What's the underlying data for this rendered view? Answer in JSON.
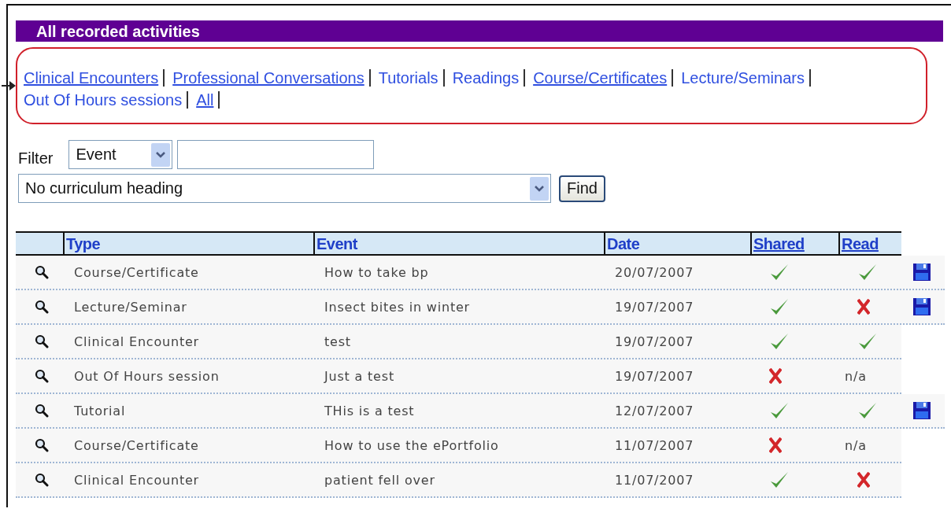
{
  "title": "All recorded activities",
  "categories": [
    {
      "label": "Clinical Encounters",
      "underlined": true
    },
    {
      "label": "Professional Conversations",
      "underlined": true
    },
    {
      "label": "Tutorials",
      "underlined": false
    },
    {
      "label": "Readings",
      "underlined": false
    },
    {
      "label": "Course/Certificates",
      "underlined": true
    },
    {
      "label": "Lecture/Seminars",
      "underlined": false
    },
    {
      "label": "Out Of Hours sessions",
      "underlined": false
    },
    {
      "label": "All",
      "underlined": true
    }
  ],
  "filter": {
    "label": "Filter",
    "field": "Event",
    "heading": "No curriculum heading",
    "button": "Find"
  },
  "table": {
    "columns": [
      {
        "label": "Type",
        "sortable": false
      },
      {
        "label": "Event",
        "sortable": false
      },
      {
        "label": "Date",
        "sortable": false
      },
      {
        "label": "Shared",
        "sortable": true
      },
      {
        "label": "Read",
        "sortable": true
      }
    ],
    "rows": [
      {
        "type": "Course/Certificate",
        "event": "How to take bp",
        "date": "20/07/2007",
        "shared": true,
        "read": {
          "kind": "yes"
        },
        "saved": true
      },
      {
        "type": "Lecture/Seminar",
        "event": "Insect bites in winter",
        "date": "19/07/2007",
        "shared": true,
        "read": {
          "kind": "no"
        },
        "saved": true
      },
      {
        "type": "Clinical Encounter",
        "event": "test",
        "date": "19/07/2007",
        "shared": true,
        "read": {
          "kind": "yes"
        },
        "saved": false
      },
      {
        "type": "Out Of Hours session",
        "event": "Just a test",
        "date": "19/07/2007",
        "shared": false,
        "read": {
          "kind": "text",
          "text": "n/a"
        },
        "saved": false
      },
      {
        "type": "Tutorial",
        "event": "THis is a test",
        "date": "12/07/2007",
        "shared": true,
        "read": {
          "kind": "yes"
        },
        "saved": true
      },
      {
        "type": "Course/Certificate",
        "event": "How to use the ePortfolio",
        "date": "11/07/2007",
        "shared": false,
        "read": {
          "kind": "text",
          "text": "n/a"
        },
        "saved": false
      },
      {
        "type": "Clinical Encounter",
        "event": "patient fell over",
        "date": "11/07/2007",
        "shared": true,
        "read": {
          "kind": "no"
        },
        "saved": false
      }
    ]
  }
}
